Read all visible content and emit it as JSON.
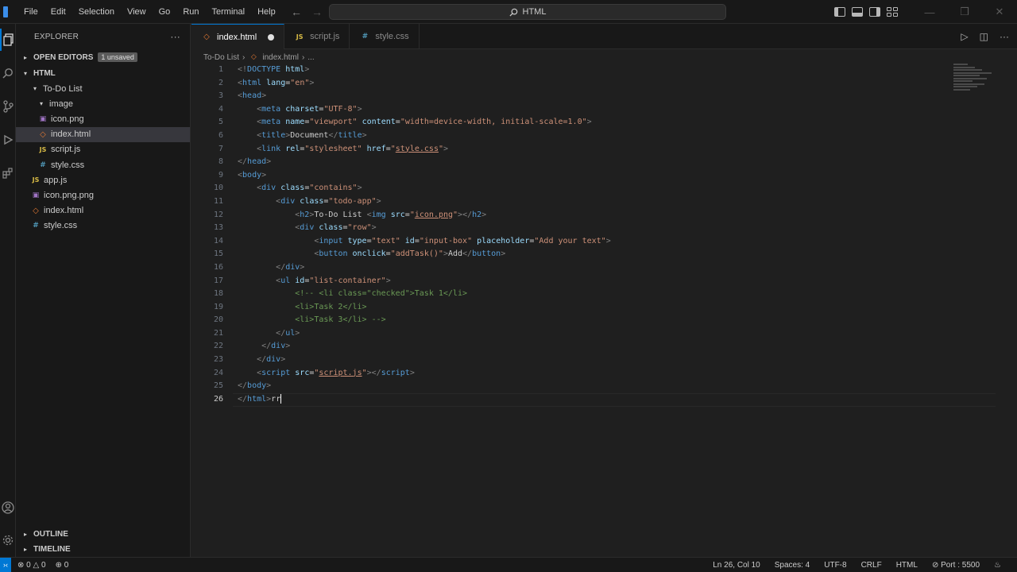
{
  "menu": [
    "File",
    "Edit",
    "Selection",
    "View",
    "Go",
    "Run",
    "Terminal",
    "Help"
  ],
  "search": {
    "label": "HTML"
  },
  "sidebar": {
    "title": "EXPLORER",
    "open_editors": {
      "label": "OPEN EDITORS",
      "badge": "1 unsaved"
    },
    "folder": "HTML",
    "tree": [
      {
        "label": "To-Do List",
        "type": "folder"
      },
      {
        "label": "image",
        "type": "folder"
      },
      {
        "label": "icon.png",
        "type": "img"
      },
      {
        "label": "index.html",
        "type": "html"
      },
      {
        "label": "script.js",
        "type": "js"
      },
      {
        "label": "style.css",
        "type": "css"
      },
      {
        "label": "app.js",
        "type": "js"
      },
      {
        "label": "icon.png.png",
        "type": "img"
      },
      {
        "label": "index.html",
        "type": "html"
      },
      {
        "label": "style.css",
        "type": "css"
      }
    ],
    "outline": "OUTLINE",
    "timeline": "TIMELINE"
  },
  "tabs": [
    {
      "label": "index.html",
      "icon": "html"
    },
    {
      "label": "script.js",
      "icon": "js"
    },
    {
      "label": "style.css",
      "icon": "css"
    }
  ],
  "breadcrumb": [
    "To-Do List",
    "index.html",
    "..."
  ],
  "editor": {
    "current_line": 26,
    "lines": [
      "1",
      "2",
      "3",
      "4",
      "5",
      "6",
      "7",
      "8",
      "9",
      "10",
      "11",
      "12",
      "13",
      "14",
      "15",
      "16",
      "17",
      "18",
      "19",
      "20",
      "21",
      "22",
      "23",
      "24",
      "25",
      "26"
    ]
  },
  "status": {
    "errors": "0",
    "warnings": "0",
    "ports": "0",
    "position": "Ln 26, Col 10",
    "spaces": "Spaces: 4",
    "encoding": "UTF-8",
    "eol": "CRLF",
    "language": "HTML",
    "port": "Port : 5500"
  }
}
